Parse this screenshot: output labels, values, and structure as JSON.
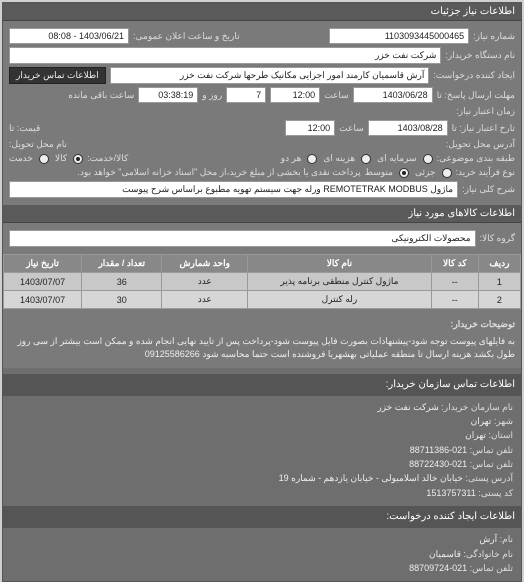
{
  "sections": {
    "need_info": "اطلاعات نیاز جزئیات"
  },
  "form": {
    "request_no_label": "شماره نیاز:",
    "request_no": "1103093445000465",
    "announce_label": "تاریخ و ساعت اعلان عمومی:",
    "announce_value": "1403/06/21 - 08:08",
    "buyer_device_label": "نام دستگاه خریدار:",
    "buyer_device": "شرکت نفت خزر",
    "requester_label": "ایجاد کننده درخواست:",
    "requester": "آرش قاسمیان کارمند امور اجرایی مکانیک طرحها شرکت نفت خزر",
    "contact_btn": "اطلاعات تماس خریدار",
    "deadline_send_label": "مهلت ارسال پاسخ: تا",
    "deadline_send_date": "1403/06/28",
    "deadline_send_time_label": "ساعت",
    "deadline_send_time": "12:00",
    "days_label": "روز و",
    "days_value": "7",
    "remain_label": "ساعت باقی مانده",
    "remain_value": "03:38:19",
    "validity_label": "زمان اعتبار نیاز:",
    "validity_to_label": "تارخ اعتبار نیاز: تا",
    "validity_date": "1403/08/28",
    "validity_time_label": "ساعت",
    "validity_time": "12:00",
    "price_label": "قیمت: تا",
    "delivery_addr_label": "آدرس محل تحویل:",
    "delivery_place_label": "نام محل تحویل:",
    "budget_label": "طبقه بندی موضوعی:",
    "budget_opts": {
      "capital": "سرمایه ای",
      "current": "هزینه ای",
      "both": "هر دو"
    },
    "goods_label": "کالا/خدمت:",
    "goods_opts": {
      "goods": "کالا",
      "service": "خدمت"
    },
    "process_label": "نوع فرآیند خرید:",
    "process_opts": {
      "low": "جزئی",
      "mid": "متوسط"
    },
    "process_note": "پرداخت نقدی یا بخشی از مبلغ خرید،از محل \"اسناد خزانه اسلامی\" خواهد بود.",
    "need_desc_label": "شرح کلی نیاز:",
    "need_desc": "ماژول REMOTETRAK MODBUS ورله جهت سیستم تهویه مطبوع براساس شرح پیوست"
  },
  "goods_section": {
    "title": "اطلاعات کالاهای مورد نیاز",
    "group_label": "گروه کالا:",
    "group_value": "محصولات الکترونیکی"
  },
  "table": {
    "headers": [
      "ردیف",
      "کد کالا",
      "نام کالا",
      "واحد شمارش",
      "تعداد / مقدار",
      "تاریخ نیاز"
    ],
    "rows": [
      [
        "1",
        "--",
        "ماژول کنترل منطقی برنامه پذیر",
        "عدد",
        "36",
        "1403/07/07"
      ],
      [
        "2",
        "--",
        "رله کنترل",
        "عدد",
        "30",
        "1403/07/07"
      ]
    ]
  },
  "buyer_notes": {
    "label": "توضیحات خریدار:",
    "text": "به فایلهای پیوست توجه شود-پیشنهادات بصورت فایل پیوست شود-پرداخت پس از تایید نهایی انجام شده و ممکن است بیشتر از سی روز طول بکشد هزینه ارسال تا منطقه عملیاتی بهشهربا فروشنده است حتما محاسبه شود 09125586266"
  },
  "contact": {
    "title1": "اطلاعات تماس سازمان خریدار:",
    "org_label": "نام سازمان خریدار:",
    "org": "شرکت نفت خزر",
    "city_label": "شهر:",
    "city": "تهران",
    "province_label": "استان:",
    "province": "تهران",
    "phone_label": "تلفن تماس:",
    "phone": "021-88711386",
    "fax_label": "تلفن تماس:",
    "fax": "021-88722430",
    "post_addr_label": "آدرس پستی:",
    "post_addr": "خیابان خالد اسلامبولی - خیابان یازدهم - شماره 19",
    "post_code_label": "کد پستی:",
    "post_code": "1513757311",
    "title2": "اطلاعات ایجاد کننده درخواست:",
    "name_label": "نام:",
    "name": "آرش",
    "family_label": "نام خانوادگی:",
    "family": "قاسمیان",
    "tel_label": "تلفن تماس:",
    "tel": "021-88709724"
  }
}
